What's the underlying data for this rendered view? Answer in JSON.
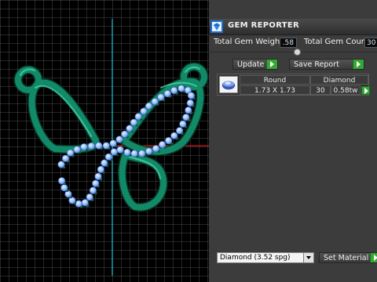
{
  "viewport": {
    "name": "3D viewport",
    "colors": {
      "background": "#000000",
      "grid": "#555555",
      "axis_y": "#1fc4d1",
      "axis_x": "#d01818",
      "metal": "#128a68",
      "gem": "#8ab8ff"
    }
  },
  "panel": {
    "title": "GEM REPORTER",
    "logo_icon": "gem-reporter-logo-icon",
    "total_weight_label": "Total Gem Weight",
    "total_weight_value": ".58",
    "total_count_label": "Total Gem Count",
    "total_count_value": "30",
    "update_label": "Update",
    "save_report_label": "Save Report",
    "gems": [
      {
        "icon": "round-gem-icon",
        "shape": "Round",
        "size": "1.73 X 1.73",
        "material": "Diamond",
        "count": "30",
        "weight": "0.58tw"
      }
    ],
    "material_select": "Diamond   (3.52 spg)",
    "set_material_label": "Set Material",
    "accent_color": "#33a833"
  }
}
